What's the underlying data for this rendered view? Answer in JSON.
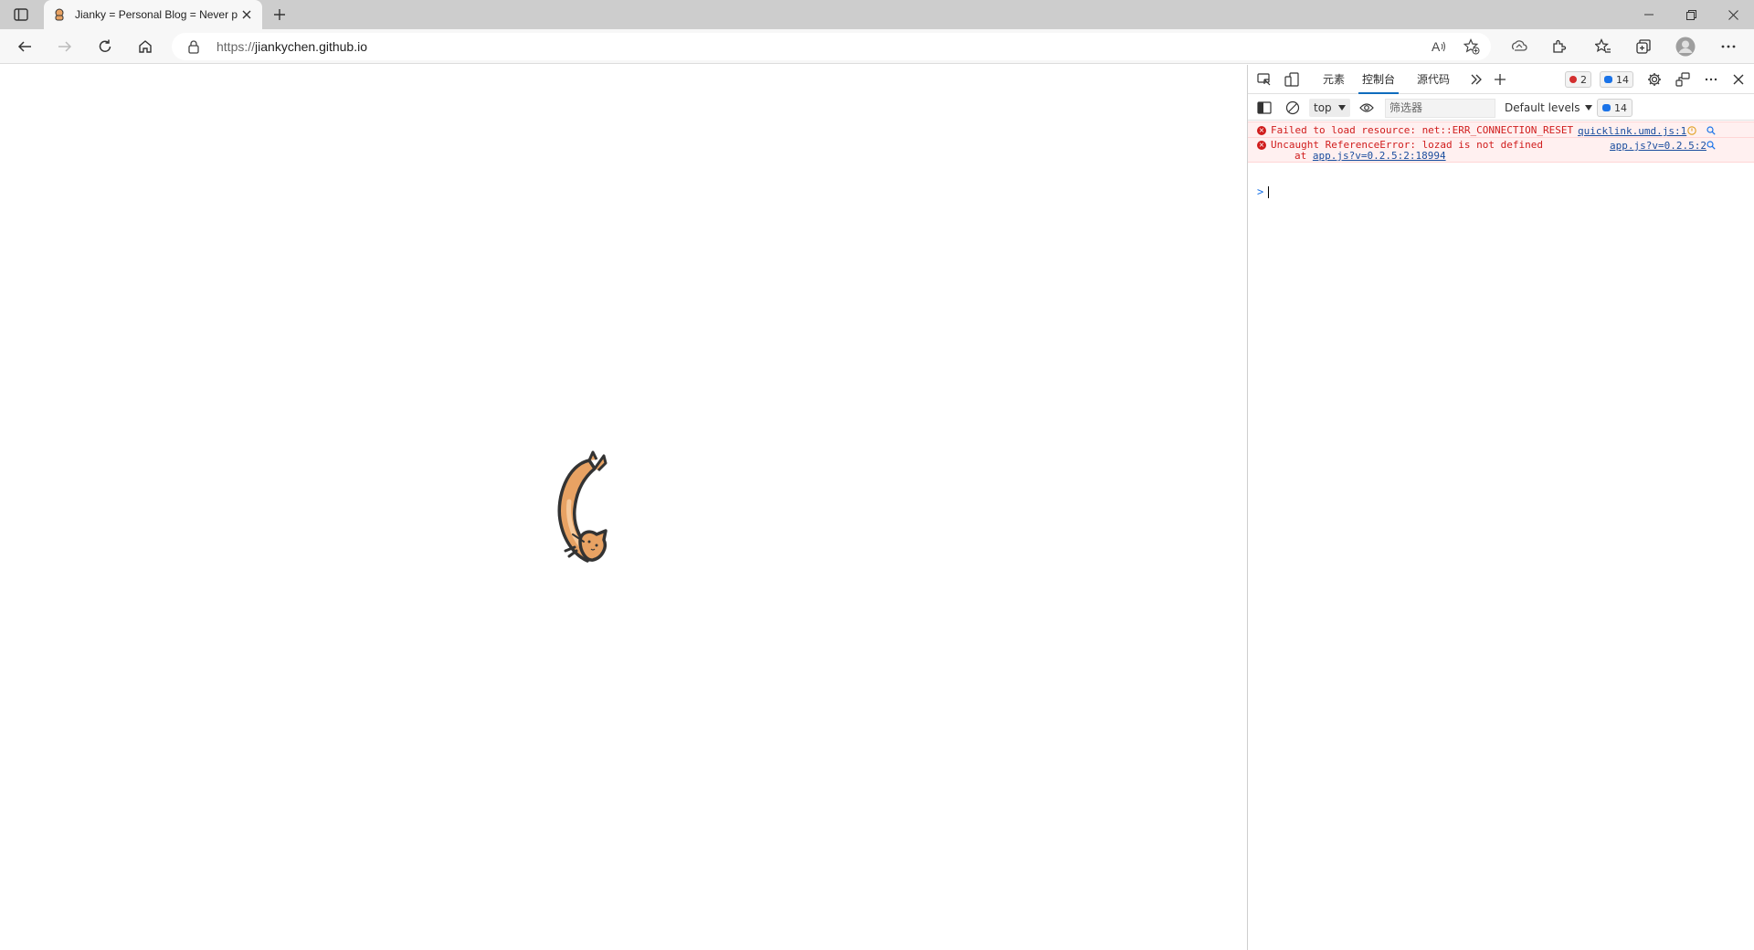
{
  "browser": {
    "tab": {
      "title": "Jianky = Personal Blog = Never p"
    },
    "address": {
      "scheme": "https://",
      "host": "jiankychen.github.io"
    }
  },
  "devtools": {
    "tabs": [
      {
        "label": "元素",
        "active": false
      },
      {
        "label": "控制台",
        "active": true
      },
      {
        "label": "源代码",
        "active": false
      }
    ],
    "error_count": "2",
    "message_count": "14",
    "filter": {
      "context": "top",
      "placeholder": "筛选器",
      "levels": "Default levels",
      "issues_count": "14"
    },
    "console": {
      "messages": [
        {
          "level": "error",
          "text": "Failed to load resource: net::ERR_CONNECTION_RESET",
          "source": "quicklink.umd.js:1"
        },
        {
          "level": "error",
          "text": "Uncaught ReferenceError: lozad is not defined",
          "source": "app.js?v=0.2.5:2",
          "stack_prefix": "at",
          "stack_link": "app.js?v=0.2.5:2:18994"
        }
      ],
      "prompt": ">"
    }
  },
  "colors": {
    "accent": "#0f6cbd",
    "error": "#d01c1c",
    "error_bg": "#fff0f0",
    "link": "#1a4d9e",
    "cat_fill": "#e8a263"
  }
}
